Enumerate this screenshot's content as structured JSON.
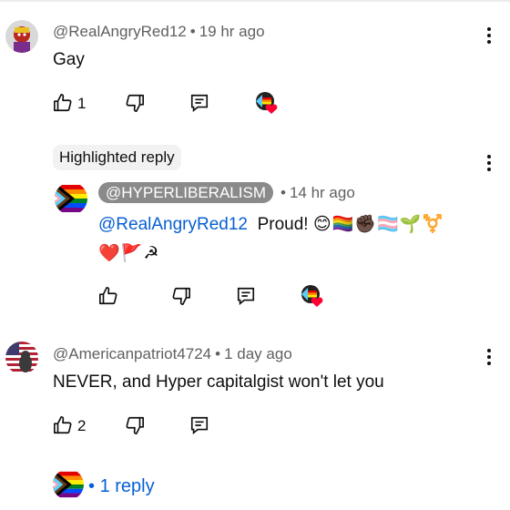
{
  "comments": [
    {
      "handle": "@RealAngryRed12",
      "time": "19 hr ago",
      "text": "Gay",
      "likes": "1",
      "avatar_icon": "red-character-avatar"
    },
    {
      "badge": "Highlighted reply",
      "handle": "@HYPERLIBERALISM",
      "time": "14 hr ago",
      "mention": "@RealAngryRed12",
      "text": "Proud!",
      "emoji_line1": "😊🏳️‍🌈✊🏿🏳️‍⚧️🌱⚧️",
      "emoji_line2": "❤️🚩☭",
      "avatar_icon": "progress-pride-flag-avatar"
    },
    {
      "handle": "@Americanpatriot4724",
      "time": "1 day ago",
      "text": "NEVER, and Hyper capitalgist won't let you",
      "likes": "2",
      "avatar_icon": "american-flag-avatar"
    }
  ],
  "replies_link": "1 reply",
  "separator": "•",
  "colors": {
    "link": "#065fd4",
    "meta": "#606060",
    "chip_bg": "#f2f2f2",
    "handle_chip_bg": "#8a8a8a"
  }
}
